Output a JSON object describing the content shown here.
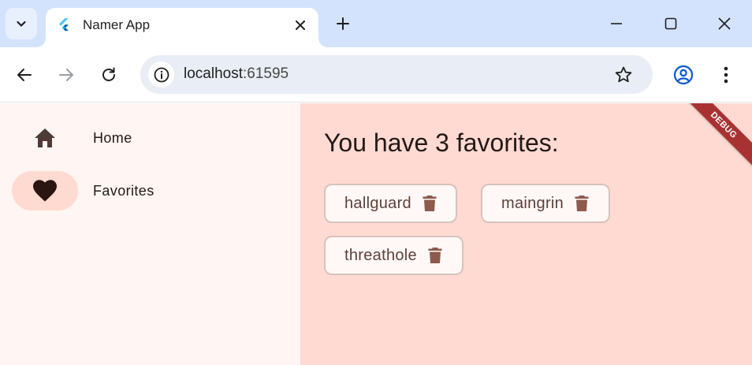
{
  "browser": {
    "tab": {
      "title": "Namer App"
    },
    "address_bar": {
      "host": "localhost",
      "port": ":61595"
    }
  },
  "icons": {
    "tab_search": "chevron-down-icon",
    "tab_favicon": "flutter-icon",
    "tab_close": "close-icon",
    "new_tab": "plus-icon",
    "minimize": "minimize-icon",
    "maximize": "maximize-icon",
    "window_close": "close-icon",
    "back": "arrow-left-icon",
    "forward": "arrow-right-icon",
    "reload": "reload-icon",
    "site_info": "info-icon",
    "bookmark": "star-icon",
    "profile": "account-icon",
    "menu": "kebab-icon"
  },
  "app": {
    "rail": {
      "items": [
        {
          "label": "Home",
          "icon": "home-icon",
          "selected": false
        },
        {
          "label": "Favorites",
          "icon": "heart-icon",
          "selected": true
        }
      ]
    },
    "favorites": {
      "heading": "You have 3 favorites:",
      "items": [
        {
          "label": "hallguard"
        },
        {
          "label": "maingrin"
        },
        {
          "label": "threathole"
        }
      ]
    },
    "debug_banner": "DEBUG"
  },
  "colors": {
    "tabbar_bg": "#d3e3fd",
    "rail_bg": "#fff5f2",
    "content_bg": "#ffdad2",
    "rail_indicator": "#ffdad0",
    "delete_icon": "#8c5b4e",
    "debug_banner": "#a83232",
    "profile_icon": "#0b57d0"
  }
}
